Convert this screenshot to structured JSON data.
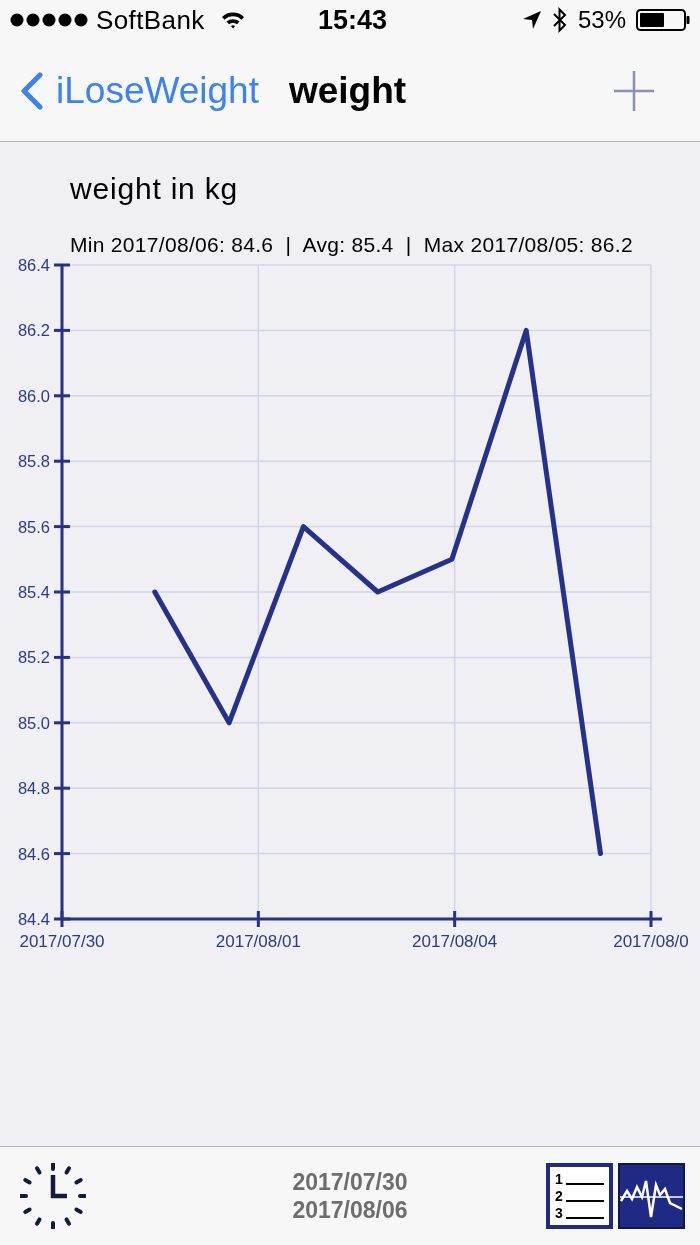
{
  "status_bar": {
    "carrier": "SoftBank",
    "time": "15:43",
    "battery": "53%"
  },
  "nav_bar": {
    "back_label": "iLoseWeight",
    "title": "weight"
  },
  "chart": {
    "title": "weight in kg",
    "summary": "Min 2017/08/06: 84.6  |  Avg: 85.4  |  Max 2017/08/05: 86.2",
    "x_axis_labels": [
      "2017/07/30",
      "2017/08/01",
      "2017/08/04",
      "2017/08/0"
    ],
    "chart_data": {
      "type": "line",
      "grid": true,
      "categories": [
        null,
        null,
        null,
        null,
        null,
        null,
        null
      ],
      "values": [
        85.4,
        85.0,
        85.6,
        85.4,
        85.5,
        86.2,
        84.6
      ],
      "ylim": [
        84.4,
        86.4
      ],
      "yticks": [
        {
          "value": 84.4,
          "label": "84.4"
        },
        {
          "value": 84.6,
          "label": "84.6"
        },
        {
          "value": 84.8,
          "label": "84.8"
        },
        {
          "value": 85.0,
          "label": "85.0"
        },
        {
          "value": 85.2,
          "label": "85.2"
        },
        {
          "value": 85.4,
          "label": "85.4"
        },
        {
          "value": 85.6,
          "label": "85.6"
        },
        {
          "value": 85.8,
          "label": "85.8"
        },
        {
          "value": 86.0,
          "label": "86.0"
        },
        {
          "value": 86.2,
          "label": "86.2"
        },
        {
          "value": 86.4,
          "label": "86.4"
        }
      ]
    }
  },
  "toolbar": {
    "range_start": "2017/07/30",
    "range_end": "2017/08/06",
    "list_button": {
      "numbers": [
        "1",
        "2",
        "3"
      ]
    }
  }
}
